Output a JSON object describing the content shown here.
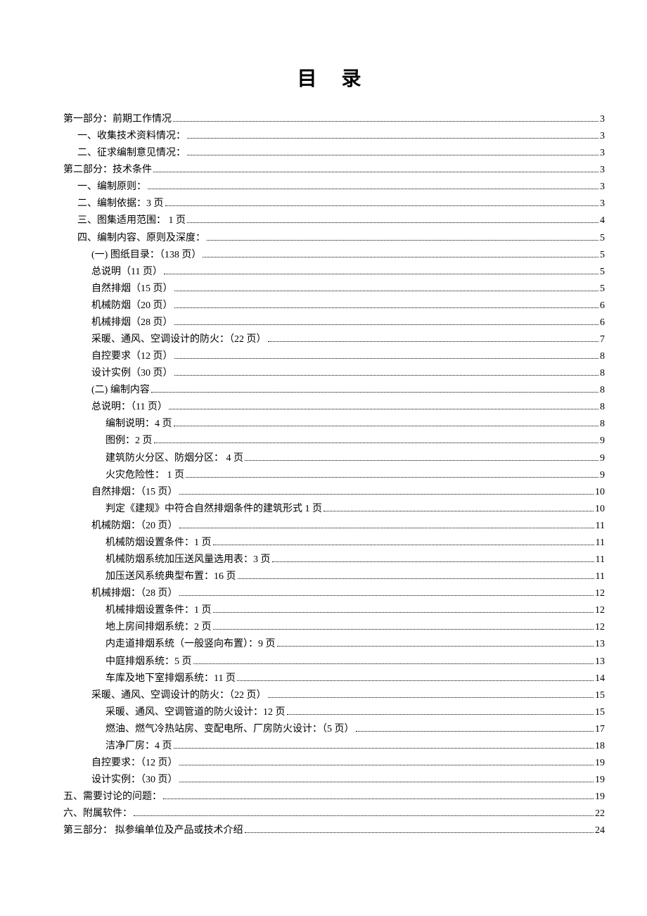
{
  "title": "目 录",
  "toc": [
    {
      "label": "第一部分：前期工作情况",
      "page": "3",
      "level": 0
    },
    {
      "label": "一、收集技术资料情况：",
      "page": "3",
      "level": 1
    },
    {
      "label": "二、征求编制意见情况：",
      "page": "3",
      "level": 1
    },
    {
      "label": "第二部分：技术条件",
      "page": "3",
      "level": 0
    },
    {
      "label": "一、编制原则：",
      "page": "3",
      "level": 1
    },
    {
      "label": "二、编制依据：3 页",
      "page": "3",
      "level": 1
    },
    {
      "label": "三、图集适用范围：  1 页",
      "page": "4",
      "level": 1
    },
    {
      "label": "四、编制内容、原则及深度：",
      "page": "5",
      "level": 1
    },
    {
      "label": "(一) 图纸目录：（138 页）",
      "page": "5",
      "level": 2
    },
    {
      "label": "总说明（11 页）",
      "page": "5",
      "level": 2
    },
    {
      "label": "自然排烟（15 页）",
      "page": "5",
      "level": 2
    },
    {
      "label": "机械防烟（20 页）",
      "page": "6",
      "level": 2
    },
    {
      "label": "机械排烟（28 页）",
      "page": "6",
      "level": 2
    },
    {
      "label": "采暖、通风、空调设计的防火：（22 页）",
      "page": "7",
      "level": 2
    },
    {
      "label": "自控要求（12 页）",
      "page": "8",
      "level": 2
    },
    {
      "label": "设计实例（30 页）",
      "page": "8",
      "level": 2
    },
    {
      "label": "(二) 编制内容",
      "page": "8",
      "level": 2
    },
    {
      "label": "总说明：（11 页）",
      "page": "8",
      "level": 2
    },
    {
      "label": "编制说明：4 页",
      "page": "8",
      "level": 3
    },
    {
      "label": "图例：2 页",
      "page": "9",
      "level": 3
    },
    {
      "label": "建筑防火分区、防烟分区：  4 页",
      "page": "9",
      "level": 3
    },
    {
      "label": "火灾危险性：  1 页",
      "page": "9",
      "level": 3
    },
    {
      "label": "自然排烟：（15 页）",
      "page": "10",
      "level": 2
    },
    {
      "label": "判定《建规》中符合自然排烟条件的建筑形式 1 页",
      "page": "10",
      "level": 3
    },
    {
      "label": "机械防烟：（20 页）",
      "page": "11",
      "level": 2
    },
    {
      "label": "机械防烟设置条件：1 页",
      "page": "11",
      "level": 3
    },
    {
      "label": "机械防烟系统加压送风量选用表：3 页",
      "page": "11",
      "level": 3
    },
    {
      "label": "加压送风系统典型布置：16 页",
      "page": "11",
      "level": 3
    },
    {
      "label": "机械排烟：（28 页）",
      "page": "12",
      "level": 2
    },
    {
      "label": "机械排烟设置条件：1 页",
      "page": "12",
      "level": 3
    },
    {
      "label": "地上房间排烟系统：2 页",
      "page": "12",
      "level": 3
    },
    {
      "label": "内走道排烟系统（一般竖向布置）：9 页",
      "page": "13",
      "level": 3
    },
    {
      "label": "中庭排烟系统：5 页",
      "page": "13",
      "level": 3
    },
    {
      "label": "车库及地下室排烟系统：11 页",
      "page": "14",
      "level": 3
    },
    {
      "label": "采暖、通风、空调设计的防火：（22 页）",
      "page": "15",
      "level": 2
    },
    {
      "label": "采暖、通风、空调管道的防火设计：12 页",
      "page": "15",
      "level": 3
    },
    {
      "label": "燃油、燃气冷热站房、变配电所、厂房防火设计：（5 页）",
      "page": "17",
      "level": 3
    },
    {
      "label": "洁净厂房：4 页",
      "page": "18",
      "level": 3
    },
    {
      "label": "自控要求：（12 页）",
      "page": "19",
      "level": 2
    },
    {
      "label": "设计实例：（30 页）",
      "page": "19",
      "level": 2
    },
    {
      "label": "五、需要讨论的问题：",
      "page": "19",
      "level": 0
    },
    {
      "label": "六、附属软件：",
      "page": "22",
      "level": 0
    },
    {
      "label": "第三部分：  拟参编单位及产品或技术介绍",
      "page": "24",
      "level": 0
    }
  ]
}
